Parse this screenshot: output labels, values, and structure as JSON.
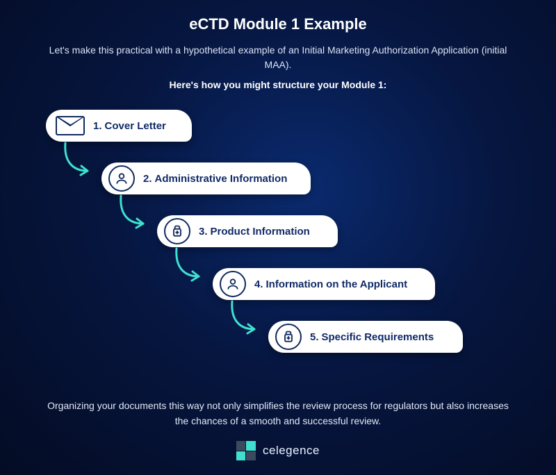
{
  "title": "eCTD Module 1 Example",
  "intro": "Let's make this practical with a hypothetical example of an Initial Marketing Authorization Application (initial MAA).",
  "subhead": "Here's how you might structure your Module 1:",
  "steps": [
    {
      "num": "1.",
      "label": "Cover Letter"
    },
    {
      "num": "2.",
      "label": "Administrative Information"
    },
    {
      "num": "3.",
      "label": "Product Information"
    },
    {
      "num": "4.",
      "label": "Information on the Applicant"
    },
    {
      "num": "5.",
      "label": "Specific Requirements"
    }
  ],
  "footer": "Organizing your documents this way not only simplifies the review process for regulators but also increases the chances of a smooth and successful review.",
  "brand": "celegence",
  "colors": {
    "accent": "#3fe0d0",
    "pill_text": "#102a66"
  }
}
